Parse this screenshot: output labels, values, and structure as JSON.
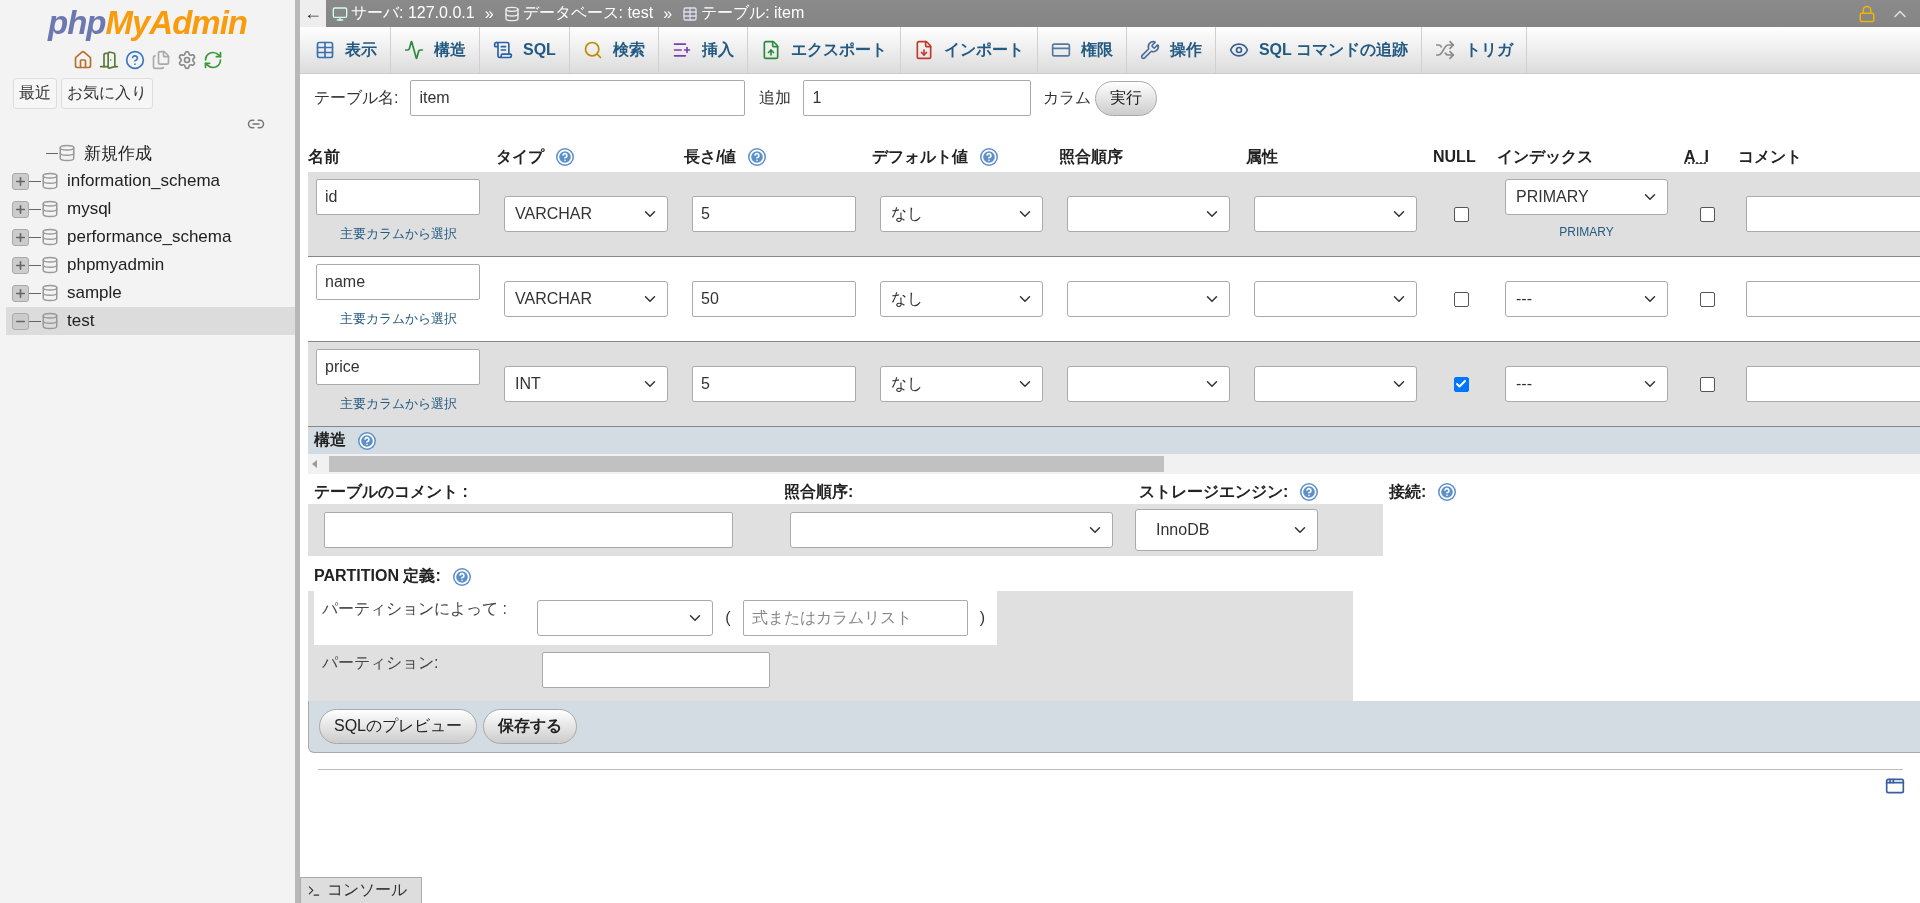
{
  "sidebar": {
    "logo": {
      "part_1": "php",
      "part_2": "MyAdmin"
    },
    "buttons": [
      "最近",
      "お気に入り"
    ],
    "tree": [
      {
        "kind": "new",
        "label": "新規作成"
      },
      {
        "kind": "db",
        "label": "information_schema",
        "expanded": false,
        "selected": false
      },
      {
        "kind": "db",
        "label": "mysql",
        "expanded": false,
        "selected": false
      },
      {
        "kind": "db",
        "label": "performance_schema",
        "expanded": false,
        "selected": false
      },
      {
        "kind": "db",
        "label": "phpmyadmin",
        "expanded": false,
        "selected": false
      },
      {
        "kind": "db",
        "label": "sample",
        "expanded": false,
        "selected": false
      },
      {
        "kind": "db",
        "label": "test",
        "expanded": true,
        "selected": true
      }
    ]
  },
  "breadcrumb": {
    "back": "←",
    "items": [
      {
        "kind": "server",
        "label": "サーバ: 127.0.0.1"
      },
      {
        "kind": "separator",
        "label": "»"
      },
      {
        "kind": "database",
        "label": "データベース: test"
      },
      {
        "kind": "separator",
        "label": "»"
      },
      {
        "kind": "table",
        "label": "テーブル: item"
      }
    ]
  },
  "tabs": [
    {
      "kind": "browse",
      "label": "表示",
      "selected": false
    },
    {
      "kind": "structure",
      "label": "構造",
      "selected": false
    },
    {
      "kind": "sql",
      "label": "SQL",
      "selected": false
    },
    {
      "kind": "search",
      "label": "検索",
      "selected": false
    },
    {
      "kind": "insert",
      "label": "挿入",
      "selected": false
    },
    {
      "kind": "export",
      "label": "エクスポート",
      "selected": false
    },
    {
      "kind": "import",
      "label": "インポート",
      "selected": false
    },
    {
      "kind": "privileges",
      "label": "権限",
      "selected": false
    },
    {
      "kind": "operations",
      "label": "操作",
      "selected": false
    },
    {
      "kind": "tracking",
      "label": "SQL コマンドの追跡",
      "selected": false
    },
    {
      "kind": "triggers",
      "label": "トリガ",
      "selected": false
    }
  ],
  "form": {
    "table_name_label": "テーブル名:",
    "table_name": "item",
    "add_label": "追加",
    "add_value": "1",
    "column_label": "カラム",
    "go": "実行"
  },
  "columns": [
    {
      "label": "名前"
    },
    {
      "label": "タイプ",
      "help": true
    },
    {
      "label": "長さ/値",
      "help": true
    },
    {
      "label": "デフォルト値",
      "help": true
    },
    {
      "label": "照合順序"
    },
    {
      "label": "属性"
    },
    {
      "label": "NULL"
    },
    {
      "label": "インデックス"
    },
    {
      "label": "A_I"
    },
    {
      "label": "コメント"
    }
  ],
  "rows": [
    {
      "name": "id",
      "link": "主要カラムから選択",
      "type": "VARCHAR",
      "length": "5",
      "default": "なし",
      "null": false,
      "index": "PRIMARY",
      "index_note": "PRIMARY",
      "ai": false
    },
    {
      "name": "name",
      "link": "主要カラムから選択",
      "type": "VARCHAR",
      "length": "50",
      "default": "なし",
      "null": false,
      "index": "---",
      "ai": false
    },
    {
      "name": "price",
      "link": "主要カラムから選択",
      "type": "INT",
      "length": "5",
      "default": "なし",
      "null": true,
      "index": "---",
      "ai": false
    }
  ],
  "structure_bar": {
    "label": "構造"
  },
  "table_options": {
    "comment_label": "テーブルのコメント :",
    "collation_label": "照合順序:",
    "engine_label": "ストレージエンジン:",
    "engine": "InnoDB",
    "connection_label": "接続:"
  },
  "partition": {
    "title": "PARTITION 定義:",
    "by_label": "パーティションによって :",
    "paren_open": "(",
    "placeholder": "式またはカラムリスト",
    "paren_close": ")",
    "partitions_label": "パーティション:"
  },
  "buttons": [
    {
      "kind": "secondary",
      "label": "SQLのプレビュー"
    },
    {
      "kind": "primary",
      "label": "保存する"
    }
  ],
  "console": {
    "label": "コンソール"
  }
}
